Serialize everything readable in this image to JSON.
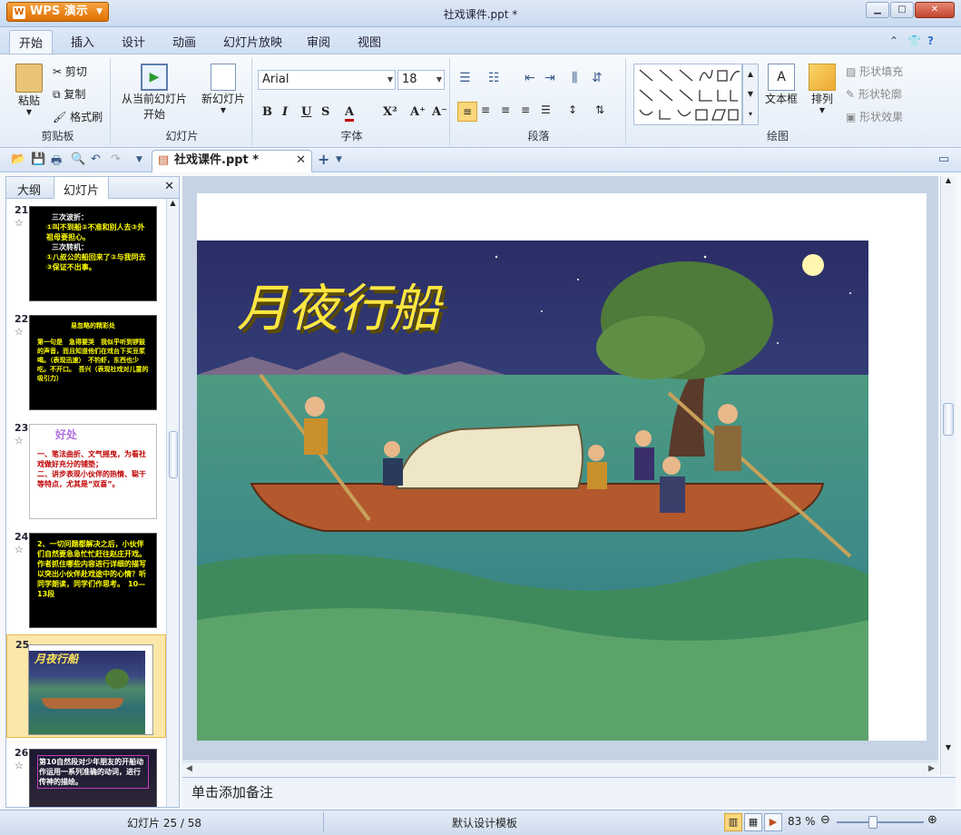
{
  "app": {
    "button_label": "WPS 演示",
    "window_title": "社戏课件.ppt *"
  },
  "menu": {
    "tabs": [
      "开始",
      "插入",
      "设计",
      "动画",
      "幻灯片放映",
      "审阅",
      "视图"
    ]
  },
  "ribbon": {
    "clipboard": {
      "paste": "粘贴",
      "cut": "剪切",
      "copy": "复制",
      "format_painter": "格式刷",
      "group": "剪贴板"
    },
    "slides": {
      "from_current_line1": "从当前幻灯片",
      "from_current_line2": "开始",
      "new_slide": "新幻灯片",
      "group": "幻灯片"
    },
    "font": {
      "name": "Arial",
      "size": "18",
      "group": "字体",
      "bold": "B",
      "italic": "I",
      "underline": "U",
      "shadow": "S",
      "color": "A",
      "superscript": "X²",
      "grow": "A⁺",
      "shrink": "A⁻"
    },
    "paragraph": {
      "group": "段落"
    },
    "drawing": {
      "textbox": "文本框",
      "arrange": "排列",
      "fill": "形状填充",
      "outline": "形状轮廓",
      "effect": "形状效果",
      "group": "绘图"
    }
  },
  "document_tab": {
    "label": "社戏课件.ppt *"
  },
  "panel": {
    "tab_outline": "大纲",
    "tab_slides": "幻灯片"
  },
  "thumbnails": [
    {
      "num": "21",
      "lines": [
        "三次波折：",
        "①叫不到船②不准和别人去③外祖母要担心。",
        "三次转机：",
        "①八叔公的船回来了②与我同去③保证不出事。"
      ]
    },
    {
      "num": "22",
      "lines": [
        "易忽略的精彩处",
        "第一句是　急得要哭　我似乎听到锣鼓的声音，而且知道他们在戏台下买豆浆喝。（表现迅速）　不钓虾，东西也少吃。不开口。　吾兴（表现社戏对儿童的吸引力）"
      ]
    },
    {
      "num": "23",
      "lines": [
        "好处",
        "一、笔法曲折、文气摇曳，为看社戏做好充分的铺垫；",
        "二、讲步表现小伙伴的热情、聪干等特点，尤其是“双喜”。"
      ]
    },
    {
      "num": "24",
      "lines": [
        "2、一切问题都解决之后，小伙伴们自然要急急忙忙赶往赵庄开戏。作者抓住哪些内容进行详细的描写以突出小伙伴赴戏途中的心情？听同学朗读，同学们作思考。　10—13段"
      ]
    },
    {
      "num": "25",
      "lines": [
        "月夜行船"
      ]
    },
    {
      "num": "26",
      "lines": [
        "第10自然段对少年朋友的开船动作运用一系列准确的动词，进行传神的描绘。"
      ]
    }
  ],
  "slide": {
    "title": "月夜行船"
  },
  "notes": {
    "placeholder": "单击添加备注"
  },
  "status": {
    "slide_counter": "幻灯片 25 / 58",
    "template": "默认设计模板",
    "zoom": "83 %"
  }
}
